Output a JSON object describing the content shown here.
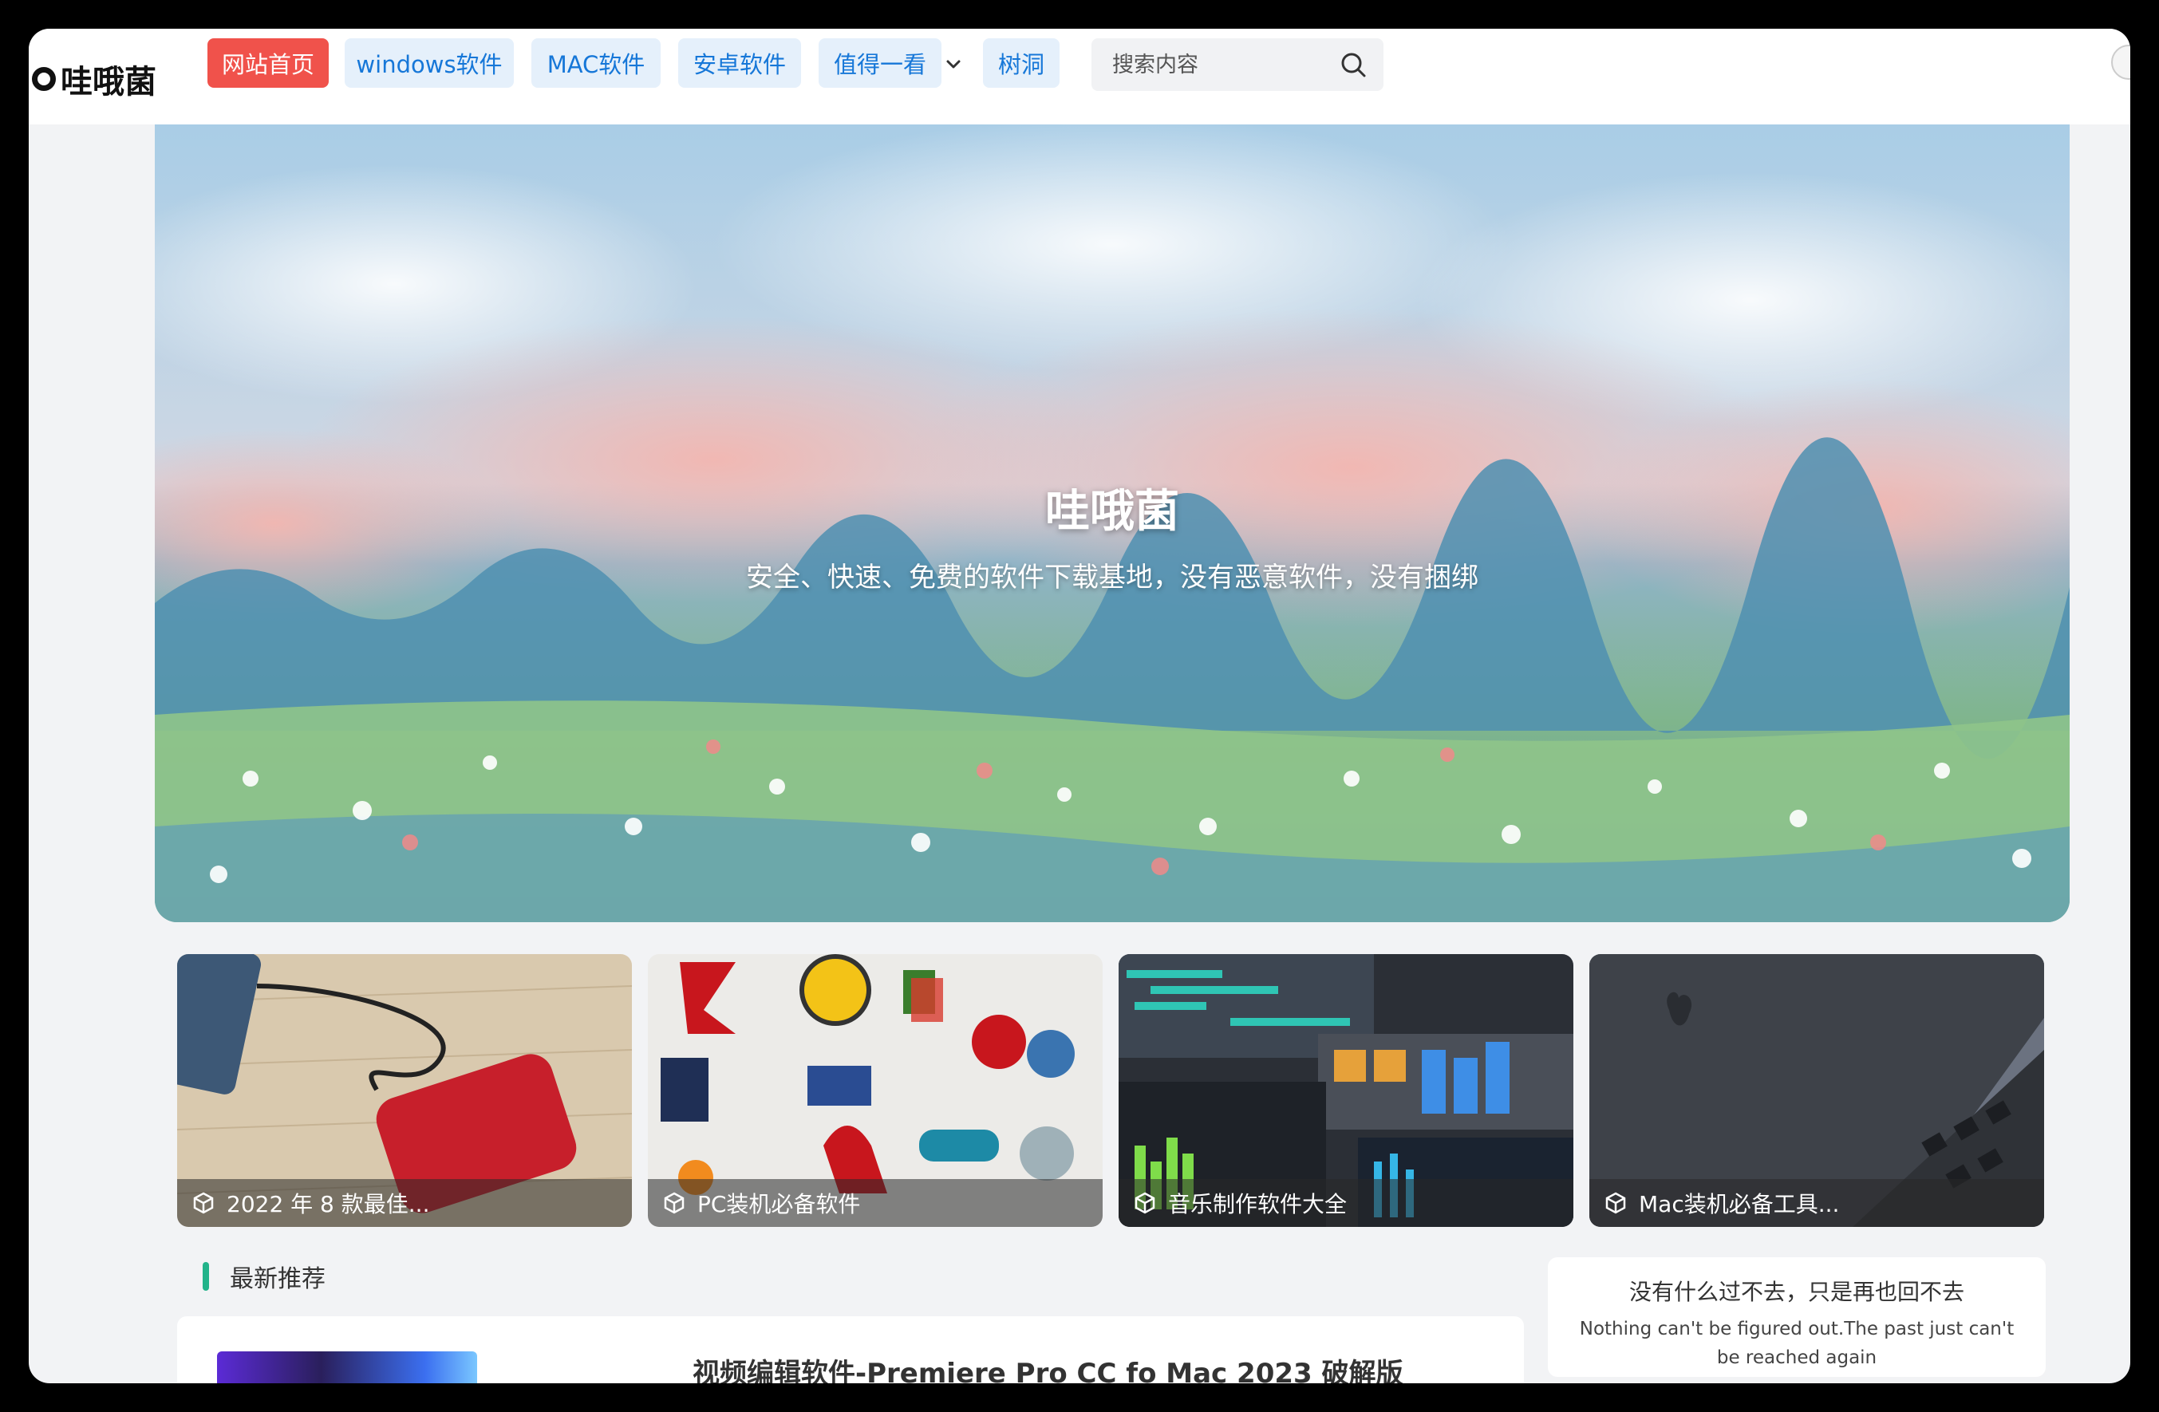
{
  "header": {
    "logo_text": "哇哦菌",
    "nav": [
      {
        "label": "网站首页",
        "active": true
      },
      {
        "label": "windows软件",
        "active": false
      },
      {
        "label": "MAC软件",
        "active": false
      },
      {
        "label": "安卓软件",
        "active": false
      },
      {
        "label": "值得一看",
        "active": false,
        "has_dropdown": true
      },
      {
        "label": "树洞",
        "active": false
      }
    ],
    "search": {
      "placeholder": "搜索内容",
      "value": ""
    }
  },
  "hero": {
    "title": "哇哦菌",
    "subtitle": "安全、快速、免费的软件下载基地，没有恶意软件，没有捆绑"
  },
  "cards": [
    {
      "label": "2022 年 8 款最佳..."
    },
    {
      "label": "PC装机必备软件"
    },
    {
      "label": "音乐制作软件大全"
    },
    {
      "label": "Mac装机必备工具..."
    }
  ],
  "latest": {
    "heading": "最新推荐",
    "article_title": "视频编辑软件-Premiere Pro CC fo Mac 2023 破解版"
  },
  "quote": {
    "cn": "没有什么过不去，只是再也回不去",
    "en": "Nothing can't be figured out.The past just can't be reached again"
  },
  "colors": {
    "accent_red": "#f0524b",
    "nav_blue": "#1677d8",
    "nav_bg": "#e5f0fb",
    "section_green": "#22b38a"
  }
}
